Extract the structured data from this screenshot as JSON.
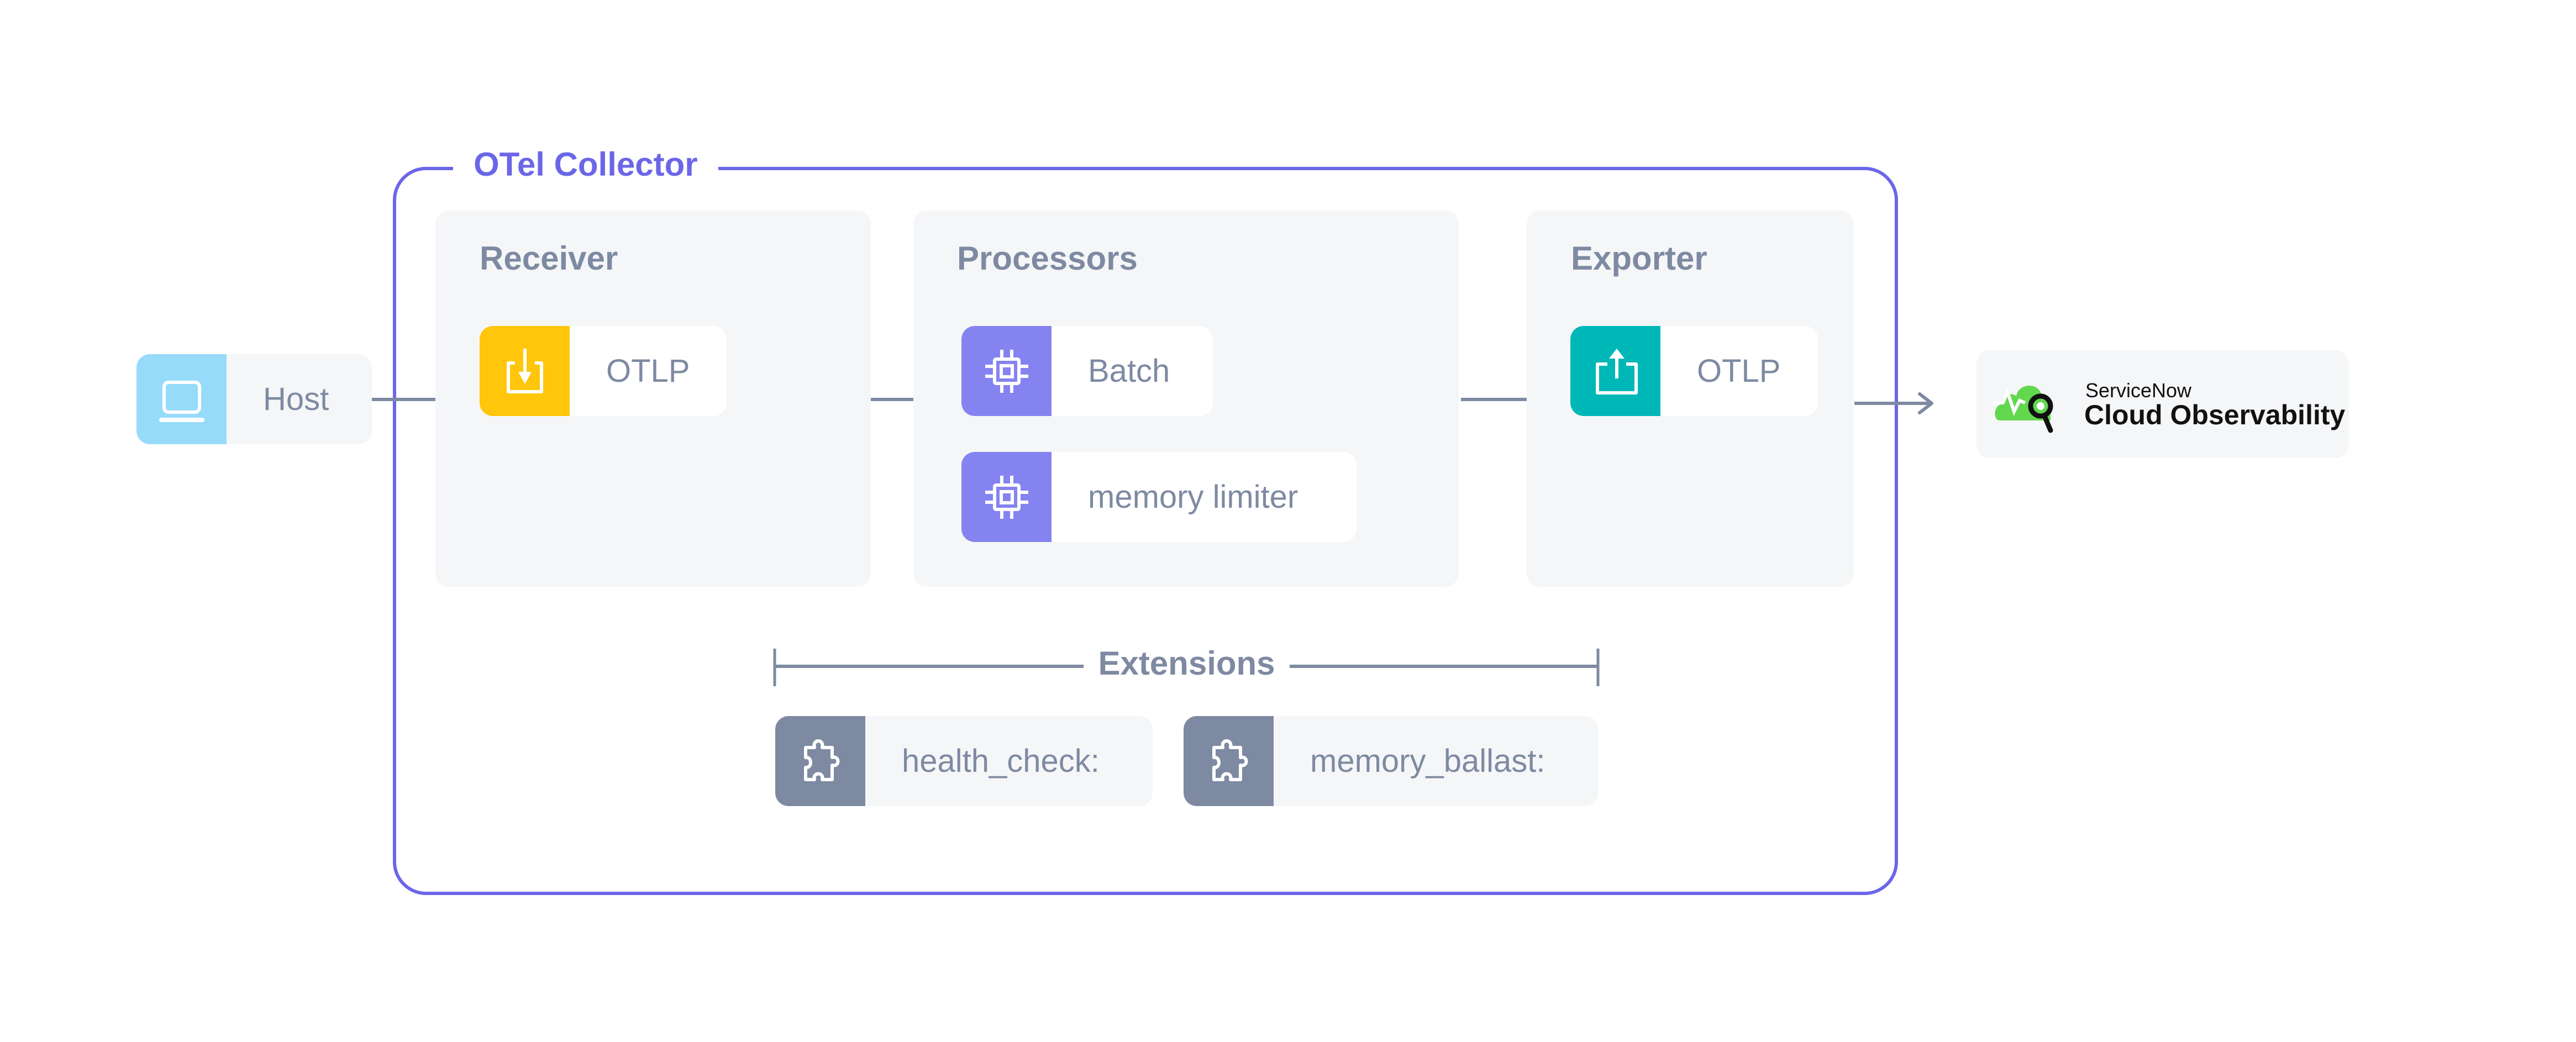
{
  "source": {
    "label": "Host",
    "icon": "laptop-icon",
    "color": "#97DBFA"
  },
  "collector": {
    "title": "OTel Collector",
    "frame_color": "#6B66E8",
    "receiver": {
      "title": "Receiver",
      "items": [
        {
          "label": "OTLP",
          "icon": "download-icon",
          "color": "#FFC60B"
        }
      ]
    },
    "processors": {
      "title": "Processors",
      "items": [
        {
          "label": "Batch",
          "icon": "cpu-chip-icon",
          "color": "#8583EF"
        },
        {
          "label": "memory limiter",
          "icon": "cpu-chip-icon",
          "color": "#8583EF"
        }
      ]
    },
    "exporter": {
      "title": "Exporter",
      "items": [
        {
          "label": "OTLP",
          "icon": "upload-share-icon",
          "color": "#00B7B8"
        }
      ]
    },
    "extensions": {
      "title": "Extensions",
      "items": [
        {
          "label": "health_check:",
          "icon": "puzzle-piece-icon",
          "color": "#7E8AA2"
        },
        {
          "label": "memory_ballast:",
          "icon": "puzzle-piece-icon",
          "color": "#7E8AA2"
        }
      ]
    }
  },
  "destination": {
    "brand_line": "ServiceNow",
    "product_line": "Cloud Observability",
    "logo_icon": "cloud-magnifier-logo-icon",
    "logo_color": "#62D84E"
  },
  "colors": {
    "text_muted": "#7E8AA2",
    "panel_bg": "#F5F6F8",
    "arrow": "#7E8AA2"
  }
}
